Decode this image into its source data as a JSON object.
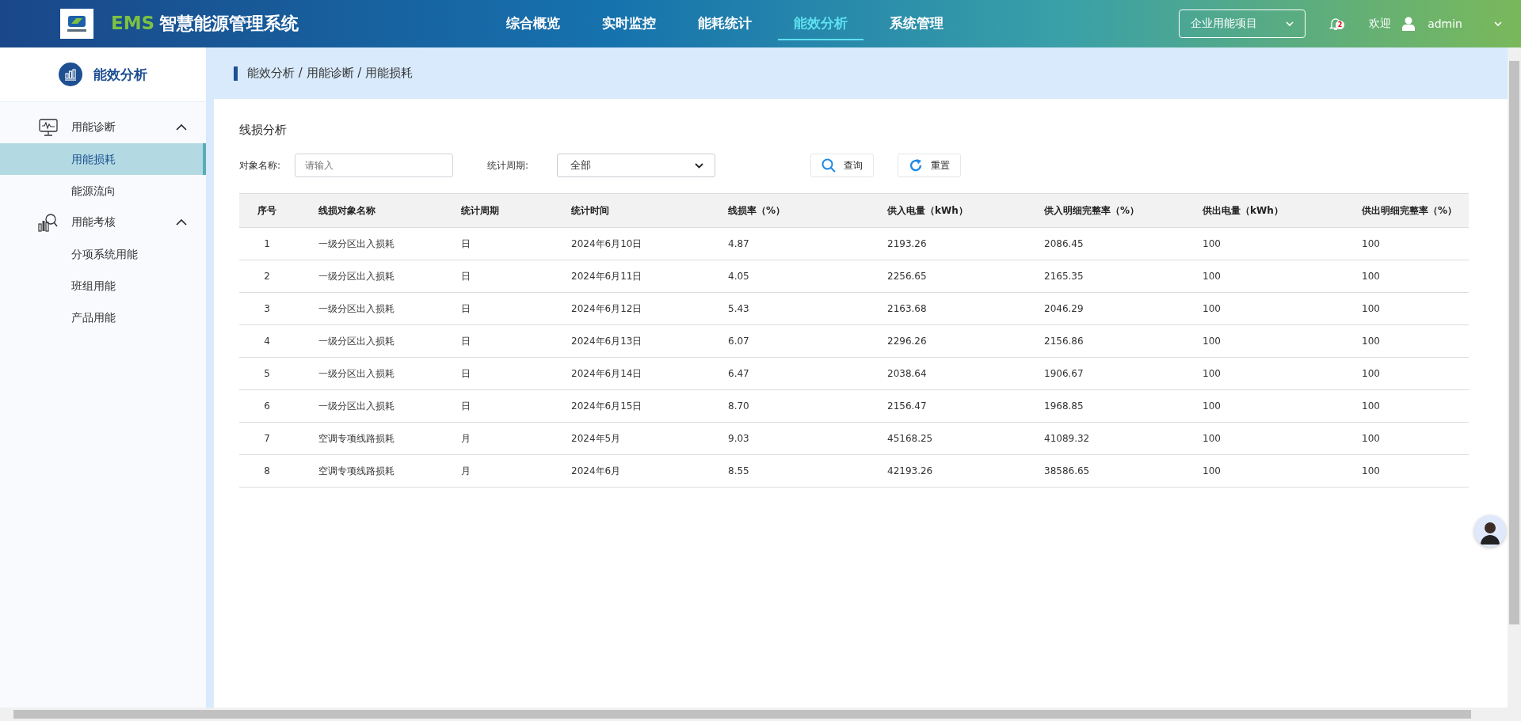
{
  "header": {
    "brand_prefix": "EMS",
    "brand_title": "智慧能源管理系统",
    "nav": [
      {
        "label": "综合概览",
        "selected": false
      },
      {
        "label": "实时监控",
        "selected": false
      },
      {
        "label": "能耗统计",
        "selected": false
      },
      {
        "label": "能效分析",
        "selected": true
      },
      {
        "label": "系统管理",
        "selected": false
      }
    ],
    "project_select": "企业用能项目",
    "notification_count": "2",
    "welcome": "欢迎",
    "user": "admin"
  },
  "sidebar": {
    "title": "能效分析",
    "groups": [
      {
        "label": "用能诊断",
        "kind": "monitor",
        "expanded": true,
        "children": [
          {
            "label": "用能损耗",
            "selected": true
          },
          {
            "label": "能源流向",
            "selected": false
          }
        ]
      },
      {
        "label": "用能考核",
        "kind": "chart-search",
        "expanded": true,
        "children": [
          {
            "label": "分项系统用能",
            "selected": false
          },
          {
            "label": "班组用能",
            "selected": false
          },
          {
            "label": "产品用能",
            "selected": false
          }
        ]
      }
    ]
  },
  "breadcrumb": "能效分析 / 用能诊断 / 用能损耗",
  "panel_title": "线损分析",
  "filters": {
    "name_label": "对象名称:",
    "name_placeholder": "请输入",
    "period_label": "统计周期:",
    "period_value": "全部",
    "search_button": "查询",
    "reset_button": "重置"
  },
  "table": {
    "columns": [
      "序号",
      "线损对象名称",
      "统计周期",
      "统计时间",
      "线损率（%）",
      "供入电量（kWh）",
      "供入明细完整率（%）",
      "供出电量（kWh）",
      "供出明细完整率（%）"
    ],
    "rows": [
      [
        "1",
        "一级分区出入损耗",
        "日",
        "2024年6月10日",
        "4.87",
        "2193.26",
        "2086.45",
        "100",
        "100"
      ],
      [
        "2",
        "一级分区出入损耗",
        "日",
        "2024年6月11日",
        "4.05",
        "2256.65",
        "2165.35",
        "100",
        "100"
      ],
      [
        "3",
        "一级分区出入损耗",
        "日",
        "2024年6月12日",
        "5.43",
        "2163.68",
        "2046.29",
        "100",
        "100"
      ],
      [
        "4",
        "一级分区出入损耗",
        "日",
        "2024年6月13日",
        "6.07",
        "2296.26",
        "2156.86",
        "100",
        "100"
      ],
      [
        "5",
        "一级分区出入损耗",
        "日",
        "2024年6月14日",
        "6.47",
        "2038.64",
        "1906.67",
        "100",
        "100"
      ],
      [
        "6",
        "一级分区出入损耗",
        "日",
        "2024年6月15日",
        "8.70",
        "2156.47",
        "1968.85",
        "100",
        "100"
      ],
      [
        "7",
        "空调专项线路损耗",
        "月",
        "2024年5月",
        "9.03",
        "45168.25",
        "41089.32",
        "100",
        "100"
      ],
      [
        "8",
        "空调专项线路损耗",
        "月",
        "2024年6月",
        "8.55",
        "42193.26",
        "38586.65",
        "100",
        "100"
      ]
    ]
  }
}
